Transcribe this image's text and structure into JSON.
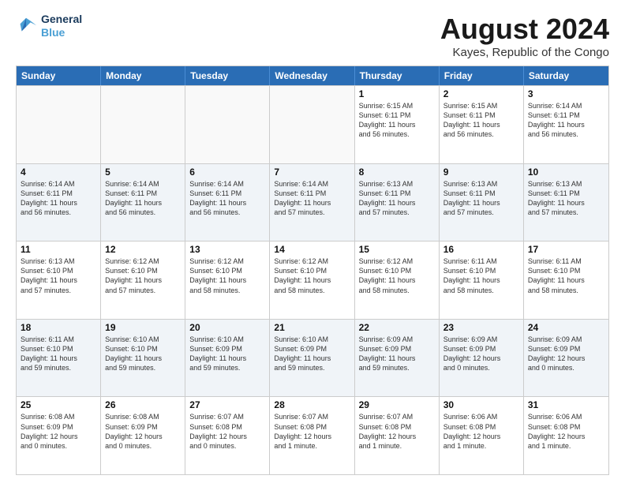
{
  "logo": {
    "line1": "General",
    "line2": "Blue"
  },
  "title": "August 2024",
  "subtitle": "Kayes, Republic of the Congo",
  "header_days": [
    "Sunday",
    "Monday",
    "Tuesday",
    "Wednesday",
    "Thursday",
    "Friday",
    "Saturday"
  ],
  "weeks": [
    [
      {
        "day": "",
        "empty": true
      },
      {
        "day": "",
        "empty": true
      },
      {
        "day": "",
        "empty": true
      },
      {
        "day": "",
        "empty": true
      },
      {
        "day": "1",
        "info": "Sunrise: 6:15 AM\nSunset: 6:11 PM\nDaylight: 11 hours\nand 56 minutes."
      },
      {
        "day": "2",
        "info": "Sunrise: 6:15 AM\nSunset: 6:11 PM\nDaylight: 11 hours\nand 56 minutes."
      },
      {
        "day": "3",
        "info": "Sunrise: 6:14 AM\nSunset: 6:11 PM\nDaylight: 11 hours\nand 56 minutes."
      }
    ],
    [
      {
        "day": "4",
        "info": "Sunrise: 6:14 AM\nSunset: 6:11 PM\nDaylight: 11 hours\nand 56 minutes."
      },
      {
        "day": "5",
        "info": "Sunrise: 6:14 AM\nSunset: 6:11 PM\nDaylight: 11 hours\nand 56 minutes."
      },
      {
        "day": "6",
        "info": "Sunrise: 6:14 AM\nSunset: 6:11 PM\nDaylight: 11 hours\nand 56 minutes."
      },
      {
        "day": "7",
        "info": "Sunrise: 6:14 AM\nSunset: 6:11 PM\nDaylight: 11 hours\nand 57 minutes."
      },
      {
        "day": "8",
        "info": "Sunrise: 6:13 AM\nSunset: 6:11 PM\nDaylight: 11 hours\nand 57 minutes."
      },
      {
        "day": "9",
        "info": "Sunrise: 6:13 AM\nSunset: 6:11 PM\nDaylight: 11 hours\nand 57 minutes."
      },
      {
        "day": "10",
        "info": "Sunrise: 6:13 AM\nSunset: 6:11 PM\nDaylight: 11 hours\nand 57 minutes."
      }
    ],
    [
      {
        "day": "11",
        "info": "Sunrise: 6:13 AM\nSunset: 6:10 PM\nDaylight: 11 hours\nand 57 minutes."
      },
      {
        "day": "12",
        "info": "Sunrise: 6:12 AM\nSunset: 6:10 PM\nDaylight: 11 hours\nand 57 minutes."
      },
      {
        "day": "13",
        "info": "Sunrise: 6:12 AM\nSunset: 6:10 PM\nDaylight: 11 hours\nand 58 minutes."
      },
      {
        "day": "14",
        "info": "Sunrise: 6:12 AM\nSunset: 6:10 PM\nDaylight: 11 hours\nand 58 minutes."
      },
      {
        "day": "15",
        "info": "Sunrise: 6:12 AM\nSunset: 6:10 PM\nDaylight: 11 hours\nand 58 minutes."
      },
      {
        "day": "16",
        "info": "Sunrise: 6:11 AM\nSunset: 6:10 PM\nDaylight: 11 hours\nand 58 minutes."
      },
      {
        "day": "17",
        "info": "Sunrise: 6:11 AM\nSunset: 6:10 PM\nDaylight: 11 hours\nand 58 minutes."
      }
    ],
    [
      {
        "day": "18",
        "info": "Sunrise: 6:11 AM\nSunset: 6:10 PM\nDaylight: 11 hours\nand 59 minutes."
      },
      {
        "day": "19",
        "info": "Sunrise: 6:10 AM\nSunset: 6:10 PM\nDaylight: 11 hours\nand 59 minutes."
      },
      {
        "day": "20",
        "info": "Sunrise: 6:10 AM\nSunset: 6:09 PM\nDaylight: 11 hours\nand 59 minutes."
      },
      {
        "day": "21",
        "info": "Sunrise: 6:10 AM\nSunset: 6:09 PM\nDaylight: 11 hours\nand 59 minutes."
      },
      {
        "day": "22",
        "info": "Sunrise: 6:09 AM\nSunset: 6:09 PM\nDaylight: 11 hours\nand 59 minutes."
      },
      {
        "day": "23",
        "info": "Sunrise: 6:09 AM\nSunset: 6:09 PM\nDaylight: 12 hours\nand 0 minutes."
      },
      {
        "day": "24",
        "info": "Sunrise: 6:09 AM\nSunset: 6:09 PM\nDaylight: 12 hours\nand 0 minutes."
      }
    ],
    [
      {
        "day": "25",
        "info": "Sunrise: 6:08 AM\nSunset: 6:09 PM\nDaylight: 12 hours\nand 0 minutes."
      },
      {
        "day": "26",
        "info": "Sunrise: 6:08 AM\nSunset: 6:09 PM\nDaylight: 12 hours\nand 0 minutes."
      },
      {
        "day": "27",
        "info": "Sunrise: 6:07 AM\nSunset: 6:08 PM\nDaylight: 12 hours\nand 0 minutes."
      },
      {
        "day": "28",
        "info": "Sunrise: 6:07 AM\nSunset: 6:08 PM\nDaylight: 12 hours\nand 1 minute."
      },
      {
        "day": "29",
        "info": "Sunrise: 6:07 AM\nSunset: 6:08 PM\nDaylight: 12 hours\nand 1 minute."
      },
      {
        "day": "30",
        "info": "Sunrise: 6:06 AM\nSunset: 6:08 PM\nDaylight: 12 hours\nand 1 minute."
      },
      {
        "day": "31",
        "info": "Sunrise: 6:06 AM\nSunset: 6:08 PM\nDaylight: 12 hours\nand 1 minute."
      }
    ]
  ]
}
